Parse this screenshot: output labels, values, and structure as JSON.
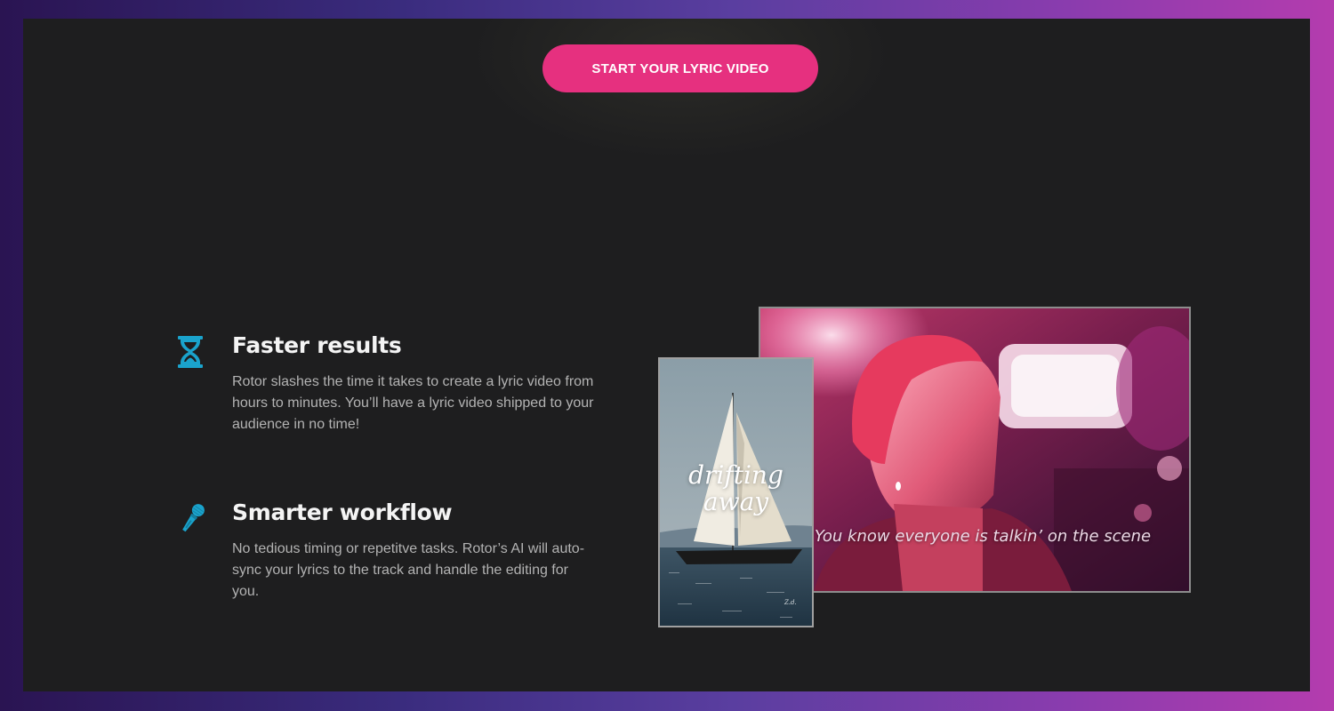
{
  "cta": {
    "label": "START YOUR LYRIC VIDEO"
  },
  "features": [
    {
      "icon": "hourglass-icon",
      "title": "Faster results",
      "description": "Rotor slashes the time it takes to create a lyric video from hours to minutes. You’ll have a lyric video shipped to your audience in no time!"
    },
    {
      "icon": "microphone-icon",
      "title": "Smarter workflow",
      "description": "No tedious timing or repetitve tasks. Rotor’s AI will auto-sync your lyrics to the track and handle the editing for you."
    }
  ],
  "previews": {
    "landscape_caption": "You know everyone is talkin’ on the scene",
    "portrait_caption": "drifting away"
  },
  "colors": {
    "accent": "#e6307f",
    "icon": "#1aa3cc",
    "background": "#1e1e1f"
  }
}
